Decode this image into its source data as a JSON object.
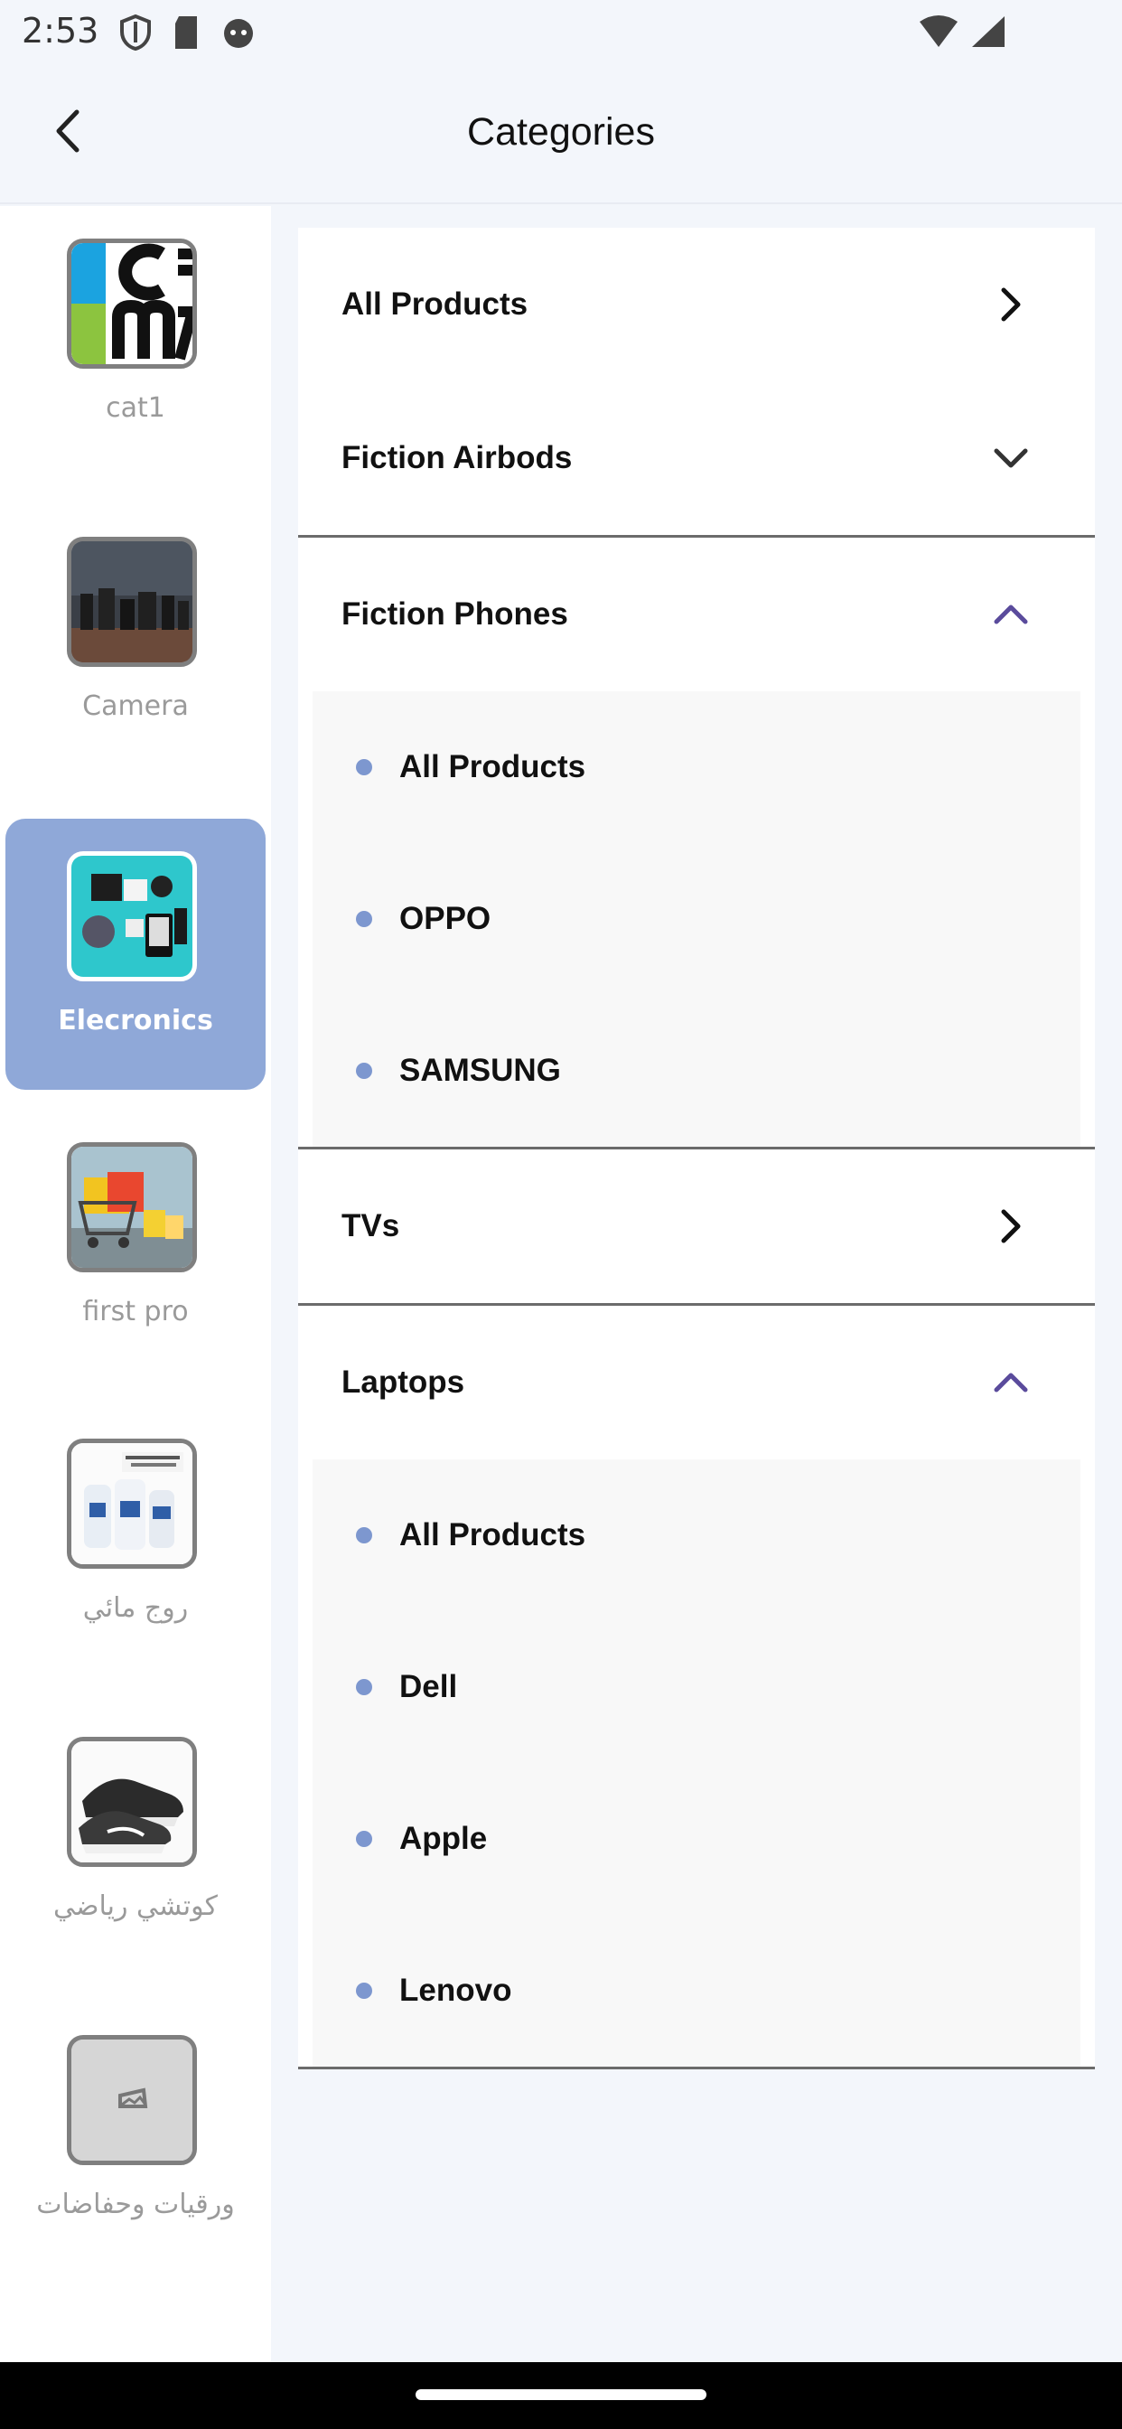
{
  "status_bar": {
    "time": "2:53"
  },
  "header": {
    "title": "Categories"
  },
  "sidebar": {
    "items": [
      {
        "label": "cat1",
        "active": false
      },
      {
        "label": "Camera",
        "active": false
      },
      {
        "label": "Elecronics",
        "active": true
      },
      {
        "label": "first pro",
        "active": false
      },
      {
        "label": "روج مائي",
        "active": false
      },
      {
        "label": "كوتشي رياضي",
        "active": false
      },
      {
        "label": "ورقيات وحفاضات",
        "active": false
      }
    ]
  },
  "categories": {
    "all_products": "All Products",
    "airbods": "Fiction Airbods",
    "phones": {
      "label": "Fiction Phones",
      "items": [
        "All Products",
        "OPPO",
        "SAMSUNG"
      ]
    },
    "tvs": "TVs",
    "laptops": {
      "label": "Laptops",
      "items": [
        "All Products",
        "Dell",
        "Apple",
        "Lenovo"
      ]
    }
  },
  "colors": {
    "accent": "#8fa8d8",
    "bullet": "#7d97cf",
    "expand_icon": "#5a4b9c"
  }
}
